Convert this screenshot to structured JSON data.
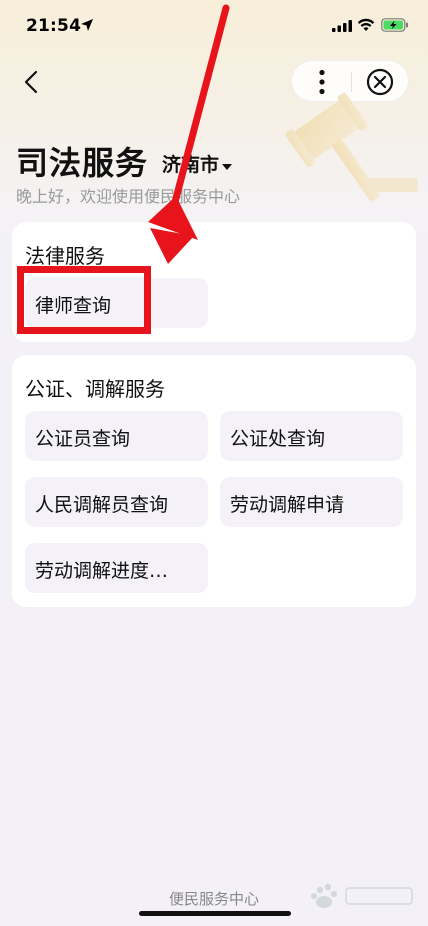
{
  "status_bar": {
    "time": "21:54",
    "icons": [
      "location-arrow-icon",
      "signal-icon",
      "wifi-icon",
      "battery-charging-icon"
    ]
  },
  "nav": {
    "back_icon": "chevron-left-icon",
    "more_icon": "more-vertical-icon",
    "close_icon": "close-circle-icon"
  },
  "header": {
    "title": "司法服务",
    "city": "济南市",
    "greeting": "晚上好，欢迎使用便民服务中心"
  },
  "sections": [
    {
      "title": "法律服务",
      "items": [
        {
          "label": "律师查询"
        }
      ]
    },
    {
      "title": "公证、调解服务",
      "items": [
        {
          "label": "公证员查询"
        },
        {
          "label": "公证处查询"
        },
        {
          "label": "人民调解员查询"
        },
        {
          "label": "劳动调解申请"
        },
        {
          "label": "劳动调解进度…"
        }
      ]
    }
  ],
  "footer": {
    "label": "便民服务中心"
  },
  "colors": {
    "annotation_red": "#e8141b",
    "tile_bg": "#f4f2f8",
    "page_bg": "#f3f1f7"
  }
}
